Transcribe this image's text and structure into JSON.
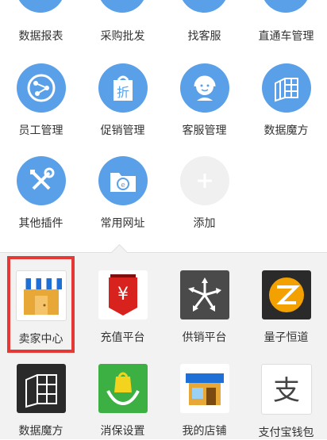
{
  "top_row_partial": [
    "数据报表",
    "采购批发",
    "找客服",
    "直通车管理"
  ],
  "circle_grid": [
    {
      "label": "员工管理",
      "icon": "share-nodes-icon"
    },
    {
      "label": "促销管理",
      "icon": "discount-tag-icon"
    },
    {
      "label": "客服管理",
      "icon": "headset-agent-icon"
    },
    {
      "label": "数据魔方",
      "icon": "cube-grid-icon"
    },
    {
      "label": "其他插件",
      "icon": "wrench-screwdriver-icon"
    },
    {
      "label": "常用网址",
      "icon": "folder-web-icon"
    },
    {
      "label": "添加",
      "icon": "plus-icon"
    }
  ],
  "app_grid": [
    {
      "label": "卖家中心",
      "icon": "storefront-icon"
    },
    {
      "label": "充值平台",
      "icon": "yuan-banner-icon"
    },
    {
      "label": "供销平台",
      "icon": "arrows-distribution-icon"
    },
    {
      "label": "量子恒道",
      "icon": "quantum-z-icon"
    },
    {
      "label": "数据魔方",
      "icon": "data-cube-icon"
    },
    {
      "label": "消保设置",
      "icon": "protection-bag-icon"
    },
    {
      "label": "我的店铺",
      "icon": "my-shop-icon"
    },
    {
      "label": "支付宝钱包",
      "icon": "alipay-icon"
    }
  ],
  "colors": {
    "accent": "#5aa0e8",
    "highlight": "#e53935"
  }
}
